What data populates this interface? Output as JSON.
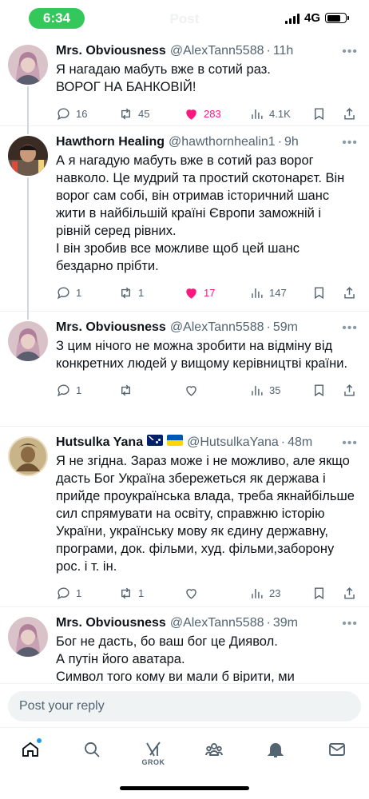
{
  "status_bar": {
    "time": "6:34",
    "network": "4G",
    "ghost_title": "Post"
  },
  "tweets": [
    {
      "name": "Mrs. Obviousness",
      "handle": "@AlexTann5588",
      "age": "11h",
      "text": "Я нагадаю мабуть вже в сотий раз.\nВОРОГ НА БАНКОВІЙ!",
      "replies": "16",
      "reposts": "45",
      "likes": "283",
      "views": "4.1K",
      "liked": true,
      "avatar": "woman-portrait"
    },
    {
      "name": "Hawthorn Healing",
      "handle": "@hawthornhealin1",
      "age": "9h",
      "text": "А я нагадую мабуть вже в сотий раз ворог навколо. Це мудрий та простий скотонарєт. Він ворог сам собі, він отримав історичний шанс жити в найбільшій країні Європи заможній і рівній серед рівних.\nІ він зробив все можливе щоб цей шанс бездарно прібти.",
      "replies": "1",
      "reposts": "1",
      "likes": "17",
      "views": "147",
      "liked": true,
      "avatar": "man-with-drinks"
    },
    {
      "name": "Mrs. Obviousness",
      "handle": "@AlexTann5588",
      "age": "59m",
      "text": "З цим нічого не можна зробити на відміну від конкретних людей у вищому керівництві країни.",
      "replies": "1",
      "reposts": "",
      "likes": "",
      "views": "35",
      "liked": false,
      "avatar": "woman-portrait"
    },
    {
      "name": "Hutsulka Yana",
      "handle": "@HutsulkaYana",
      "age": "48m",
      "text": "Я не згідна. Зараз може і не можливо, але якщо дасть Бог Україна збережеться як держава і прийде проукраїнська влада, треба якнайбільше сил спрямувати на освіту, справжню історію України, українську мову як єдину державну, програми, док. фільми, худ. фільми,заборону рос. і т. ін.",
      "replies": "1",
      "reposts": "1",
      "likes": "",
      "views": "23",
      "liked": false,
      "avatar": "sepia-portrait",
      "flags": [
        "australia-flag",
        "ukraine-flag"
      ]
    },
    {
      "name": "Mrs. Obviousness",
      "handle": "@AlexTann5588",
      "age": "39m",
      "text": "Бог не дасть, бо ваш бог це Диявол.\nА путін його аватара.\nСимвол того кому ви мали б вірити, ми",
      "avatar": "woman-portrait"
    }
  ],
  "reply_bar": {
    "placeholder": "Post your reply"
  },
  "bottom_nav": {
    "items": [
      "home-icon",
      "search-icon",
      "grok-icon",
      "communities-icon",
      "notifications-icon",
      "messages-icon"
    ],
    "grok_label": "GROK"
  },
  "colors": {
    "like": "#f91880",
    "accent": "#1d9bf0",
    "time_pill": "#34c759",
    "muted": "#536471"
  }
}
